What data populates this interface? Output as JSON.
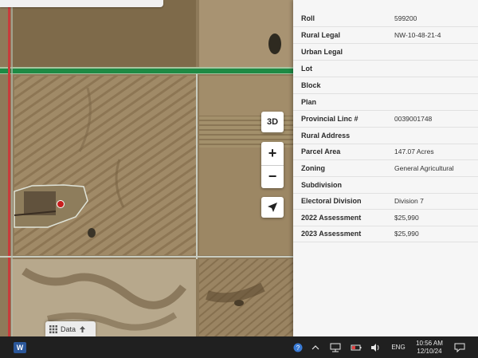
{
  "map": {
    "controls": {
      "three_d_label": "3D",
      "zoom_in_label": "+",
      "zoom_out_label": "−"
    },
    "data_button": {
      "label": "Data"
    },
    "marker_color": "#c81e1e"
  },
  "parcel_info": [
    {
      "label": "Roll",
      "value": "599200"
    },
    {
      "label": "Rural Legal",
      "value": "NW-10-48-21-4"
    },
    {
      "label": "Urban Legal",
      "value": ""
    },
    {
      "label": "Lot",
      "value": ""
    },
    {
      "label": "Block",
      "value": ""
    },
    {
      "label": "Plan",
      "value": ""
    },
    {
      "label": "Provincial Linc #",
      "value": "0039001748"
    },
    {
      "label": "Rural Address",
      "value": ""
    },
    {
      "label": "Parcel Area",
      "value": "147.07 Acres"
    },
    {
      "label": "Zoning",
      "value": "General Agricultural"
    },
    {
      "label": "Subdivision",
      "value": ""
    },
    {
      "label": "Electoral Division",
      "value": "Division 7"
    },
    {
      "label": "2022 Assessment",
      "value": "$25,990"
    },
    {
      "label": "2023 Assessment",
      "value": "$25,990"
    }
  ],
  "taskbar": {
    "language": "ENG",
    "time": "10:56 AM",
    "date": "12/10/24",
    "word_letter": "W"
  }
}
